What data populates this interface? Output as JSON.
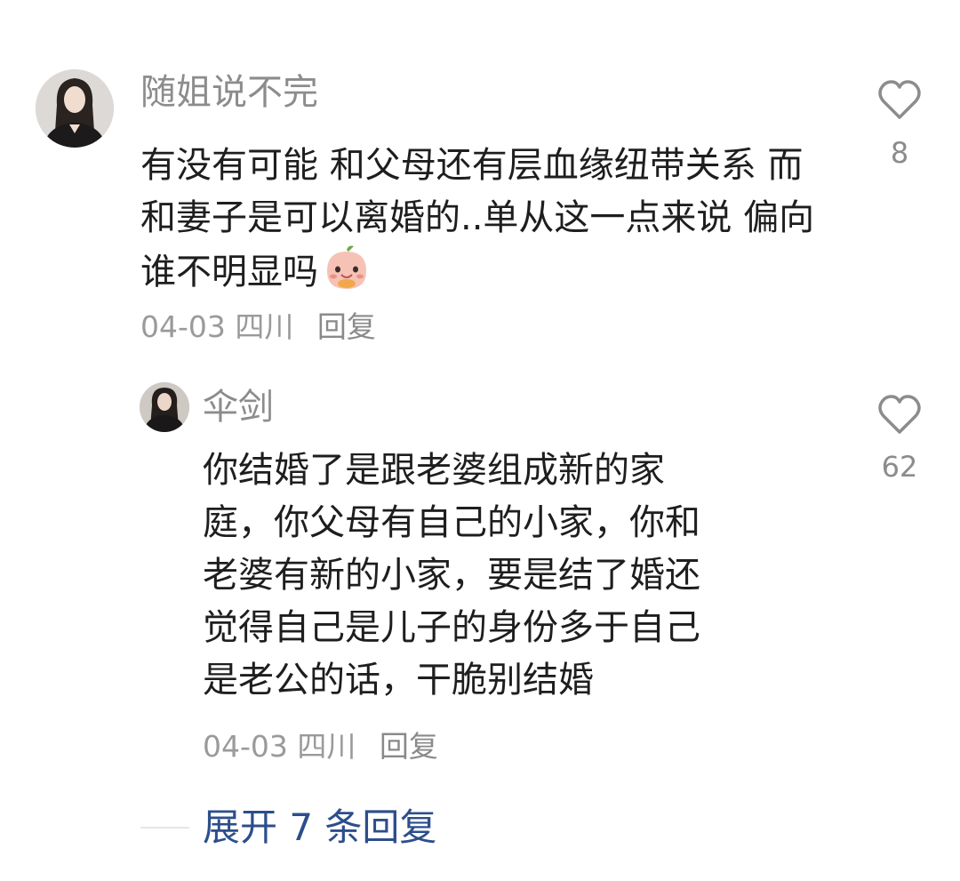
{
  "comments": [
    {
      "username": "随姐说不完",
      "text": "有没有可能 和父母还有层血缘纽带关系 而和妻子是可以离婚的..单从这一点来说 偏向谁不明显吗",
      "emoji_icon": "peach-face-emoji",
      "date": "04-03",
      "location": "四川",
      "reply_label": "回复",
      "likes": "8",
      "like_icon": "heart-outline-icon"
    }
  ],
  "reply": {
    "username": "伞剑",
    "lines": [
      "你结婚了是跟老婆组成新的家",
      "庭，你父母有自己的小家，你和",
      "老婆有新的小家，要是结了婚还",
      "觉得自己是儿子的身份多于自己",
      "是老公的话，干脆别结婚"
    ],
    "date": "04-03",
    "location": "四川",
    "reply_label": "回复",
    "likes": "62",
    "like_icon": "heart-outline-icon"
  },
  "expand_replies_label": "展开 7 条回复",
  "colors": {
    "username": "#8c8c8c",
    "text": "#1e1e1e",
    "meta": "#9a9a9a",
    "link": "#2c4e8a"
  }
}
